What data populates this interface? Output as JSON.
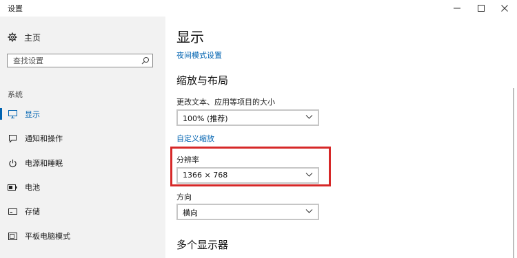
{
  "window": {
    "title": "设置",
    "controls": [
      "minimize-icon",
      "maximize-icon",
      "close-icon"
    ]
  },
  "sidebar": {
    "home": {
      "label": "主页",
      "icon": "gear-icon"
    },
    "search": {
      "placeholder": "查找设置",
      "icon": "search-icon"
    },
    "section": "系统",
    "items": [
      {
        "label": "显示",
        "icon": "monitor-icon",
        "active": true
      },
      {
        "label": "通知和操作",
        "icon": "notification-icon",
        "active": false
      },
      {
        "label": "电源和睡眠",
        "icon": "power-icon",
        "active": false
      },
      {
        "label": "电池",
        "icon": "battery-icon",
        "active": false
      },
      {
        "label": "存储",
        "icon": "storage-icon",
        "active": false
      },
      {
        "label": "平板电脑模式",
        "icon": "tablet-icon",
        "active": false
      }
    ]
  },
  "main": {
    "title": "显示",
    "night_light_link": "夜间模式设置",
    "scale_section": "缩放与布局",
    "scale_label": "更改文本、应用等项目的大小",
    "scale_value": "100% (推荐)",
    "custom_scaling_link": "自定义缩放",
    "resolution_label": "分辨率",
    "resolution_value": "1366 × 768",
    "orientation_label": "方向",
    "orientation_value": "横向",
    "multi_display_section": "多个显示器"
  },
  "colors": {
    "accent": "#0063b1",
    "sidebar_bg": "#f2f2f2",
    "highlight": "#d62828"
  }
}
